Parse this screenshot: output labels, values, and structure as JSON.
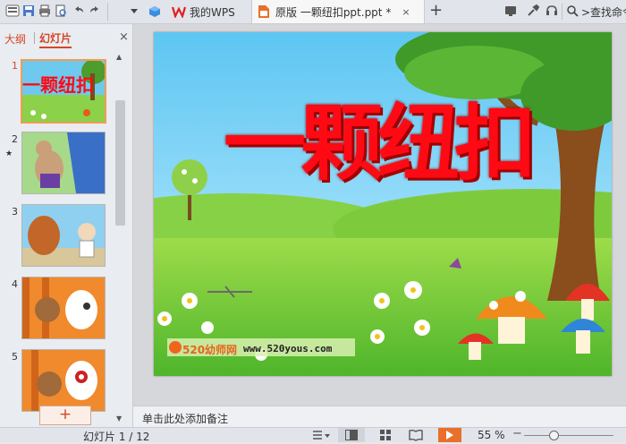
{
  "tabs": [
    {
      "label": "我的WPS"
    },
    {
      "label": "原版 一颗纽扣ppt.ppt *",
      "close": "×"
    }
  ],
  "quick_access_icons": [
    "wps-logo-icon",
    "save-icon",
    "print-icon",
    "print-preview-icon",
    "undo-icon",
    "redo-icon",
    "dropdown-icon"
  ],
  "new_tab": "+",
  "search": {
    "label": ">查找命令"
  },
  "left_pane": {
    "tab_outline": "大纲",
    "tab_slides": "幻灯片",
    "close": "×",
    "thumbnails": [
      {
        "number": "1",
        "selected": true,
        "caption": "一颗纽扣"
      },
      {
        "number": "2",
        "anim": "★"
      },
      {
        "number": "3"
      },
      {
        "number": "4"
      },
      {
        "number": "5"
      }
    ],
    "add_slide": "+"
  },
  "slide": {
    "title": "一颗纽扣",
    "brand": "520幼师网",
    "url": "www.520yous.com"
  },
  "notes": {
    "placeholder": "单击此处添加备注"
  },
  "status": {
    "slide_indicator": "幻灯片 1 / 12",
    "zoom": "55 %",
    "zoom_level": 0.55
  },
  "colors": {
    "accent": "#d24726",
    "title_red": "#ff0a14",
    "selection": "#f39b52"
  }
}
